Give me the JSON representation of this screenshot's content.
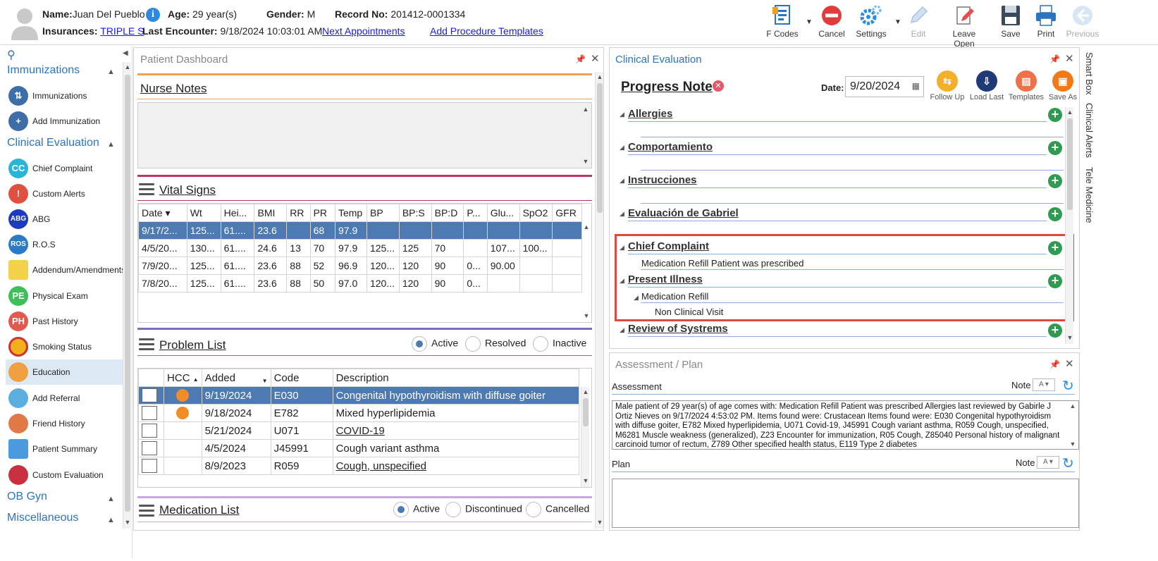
{
  "header": {
    "name_label": "Name:",
    "name": "Juan Del Pueblo",
    "age_label": "Age:",
    "age": "29 year(s)",
    "gender_label": "Gender:",
    "gender": "M",
    "record_label": "Record No:",
    "record": "201412-0001334",
    "insurances_label": "Insurances:",
    "insurance": "TRIPLE S",
    "last_encounter_label": "Last Encounter:",
    "last_encounter": "9/18/2024 10:03:01 AM",
    "next_appointments": "Next Appointments",
    "add_procedure_templates": "Add Procedure Templates"
  },
  "toolbar": {
    "fcodes": "F Codes",
    "cancel": "Cancel",
    "settings": "Settings",
    "edit": "Edit",
    "leave_open": "Leave Open",
    "save": "Save",
    "print": "Print",
    "previous": "Previous"
  },
  "sidebar": {
    "immunizations_header": "Immunizations",
    "clinical_header": "Clinical Evaluation",
    "obgyn_header": "OB Gyn",
    "misc_header": "Miscellaneous",
    "immunization_items": [
      {
        "label": "Immunizations"
      },
      {
        "label": "Add Immunization"
      }
    ],
    "clinical_items": [
      {
        "label": "Chief Complaint",
        "icon": "CC"
      },
      {
        "label": "Custom Alerts",
        "icon": "!"
      },
      {
        "label": "ABG",
        "icon": "ABG"
      },
      {
        "label": "R.O.S",
        "icon": "ROS"
      },
      {
        "label": "Addendum/Amendments",
        "icon": ""
      },
      {
        "label": "Physical Exam",
        "icon": "PE"
      },
      {
        "label": "Past History",
        "icon": "PH"
      },
      {
        "label": "Smoking Status",
        "icon": ""
      },
      {
        "label": "Education",
        "icon": ""
      },
      {
        "label": "Add Referral",
        "icon": ""
      },
      {
        "label": "Friend History",
        "icon": ""
      },
      {
        "label": "Patient Summary",
        "icon": ""
      },
      {
        "label": "Custom Evaluation",
        "icon": ""
      }
    ]
  },
  "dashboard": {
    "title": "Patient Dashboard",
    "nurse_notes": "Nurse Notes",
    "vital_signs": "Vital Signs",
    "vital_columns": [
      "Date",
      "Wt",
      "Hei...",
      "BMI",
      "RR",
      "PR",
      "Temp",
      "BP",
      "BP:S",
      "BP:D",
      "P...",
      "Glu...",
      "SpO2",
      "GFR"
    ],
    "vital_rows": [
      [
        "9/17/2...",
        "125...",
        "61....",
        "23.6",
        "",
        "68",
        "97.9",
        "",
        "",
        "",
        "",
        "",
        "",
        ""
      ],
      [
        "4/5/20...",
        "130...",
        "61....",
        "24.6",
        "13",
        "70",
        "97.9",
        "125...",
        "125",
        "70",
        "",
        "107...",
        "100...",
        ""
      ],
      [
        "7/9/20...",
        "125...",
        "61....",
        "23.6",
        "88",
        "52",
        "96.9",
        "120...",
        "120",
        "90",
        "0...",
        "90.00",
        "",
        ""
      ],
      [
        "7/8/20...",
        "125...",
        "61....",
        "23.6",
        "88",
        "50",
        "97.0",
        "120...",
        "120",
        "90",
        "0...",
        "",
        "",
        ""
      ]
    ],
    "problem_list": "Problem List",
    "problem_filters": {
      "active": "Active",
      "resolved": "Resolved",
      "inactive": "Inactive"
    },
    "problem_columns": [
      "HCC",
      "Added",
      "Code",
      "Description"
    ],
    "problem_rows": [
      {
        "hcc": true,
        "added": "9/19/2024",
        "code": "E030",
        "desc": "Congenital hypothyroidism with diffuse goiter"
      },
      {
        "hcc": true,
        "added": "9/18/2024",
        "code": "E782",
        "desc": "Mixed hyperlipidemia"
      },
      {
        "hcc": false,
        "added": "5/21/2024",
        "code": "U071",
        "desc": "COVID-19"
      },
      {
        "hcc": false,
        "added": "4/5/2024",
        "code": "J45991",
        "desc": "Cough variant asthma"
      },
      {
        "hcc": false,
        "added": "8/9/2023",
        "code": "R059",
        "desc": "Cough, unspecified"
      }
    ],
    "medication_list": "Medication List",
    "medication_filters": {
      "active": "Active",
      "discontinued": "Discontinued",
      "cancelled": "Cancelled"
    }
  },
  "clinical": {
    "title": "Clinical Evaluation",
    "note_title": "Progress Note",
    "date_label": "Date:",
    "date_value": "9/20/2024",
    "actions": {
      "follow_up": "Follow Up",
      "load_last": "Load Last",
      "templates": "Templates",
      "save_as": "Save As"
    },
    "sections": {
      "allergies": "Allergies",
      "comportamiento": "Comportamiento",
      "instrucciones": "Instrucciones",
      "evaluacion": "Evaluación de Gabriel",
      "chief_complaint": "Chief Complaint",
      "chief_complaint_text": "Medication Refill Patient was prescribed",
      "present_illness": "Present Illness",
      "present_illness_sub": "Medication Refill",
      "present_illness_sub2": "Non Clinical Visit",
      "ros": "Review of Systrems"
    }
  },
  "assessment": {
    "title": "Assessment / Plan",
    "assessment_label": "Assessment",
    "note_label": "Note",
    "assessment_text": "Male patient of 29 year(s) of age comes with: Medication Refill Patient was prescribed     Allergies last reviewed by Gabirle J Ortiz Nieves on 9/17/2024 4:53:02 PM.    Items found were:  Crustacean  Items found were:  E030 Congenital hypothyroidism with diffuse goiter, E782 Mixed hyperlipidemia, U071 Covid-19, J45991 Cough variant asthma, R059 Cough, unspecified, M6281 Muscle weakness (generalized), Z23 Encounter for immunization, R05 Cough, Z85040 Personal history of malignant carcinoid tumor of rectum, Z789 Other specified health status, E119 Type 2 diabetes",
    "plan_label": "Plan"
  },
  "right_tabs": [
    "Smart Box",
    "Clinical Alerts",
    "Tele Medicine"
  ],
  "colors": {
    "accent": "#2a74c0",
    "selected_row": "#4e7ab3",
    "highlight_box": "#e0483e",
    "add_green": "#2e9b50"
  }
}
